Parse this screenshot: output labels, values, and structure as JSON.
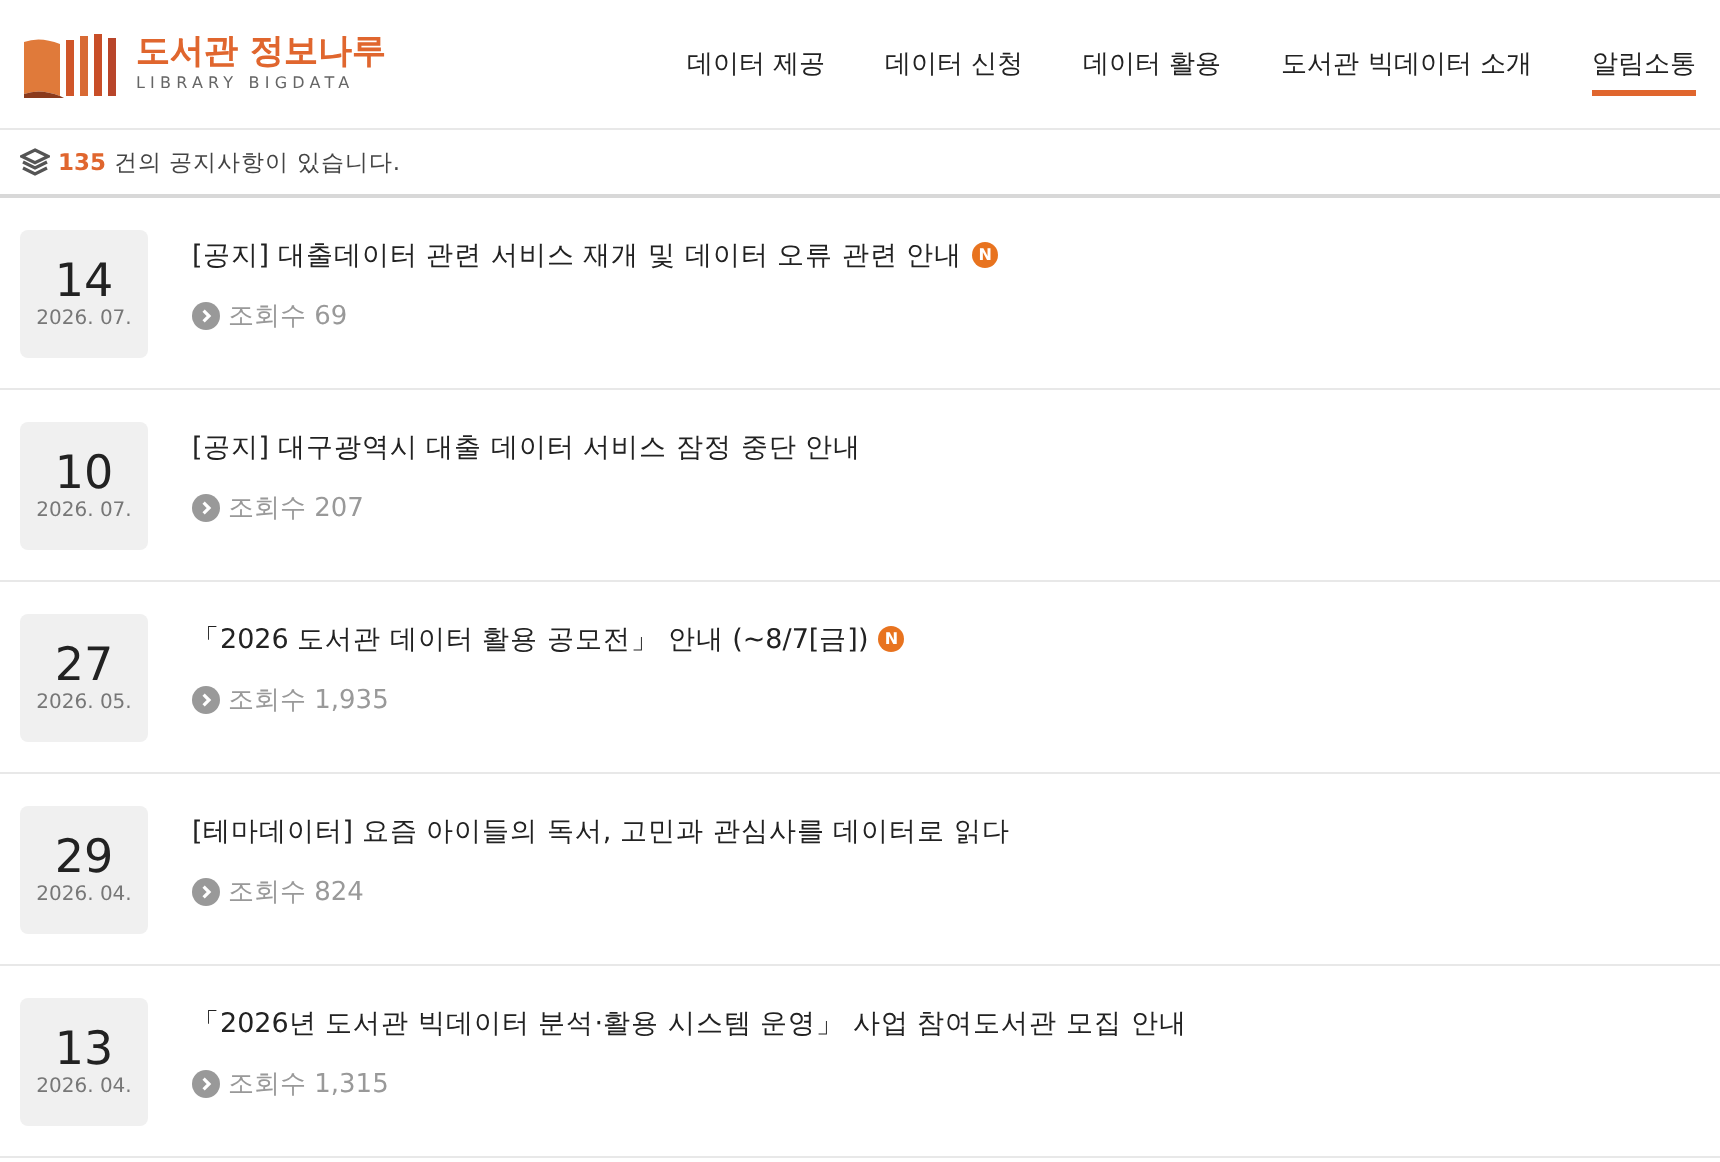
{
  "logo": {
    "title": "도서관 정보나루",
    "subtitle": "LIBRARY BIGDATA"
  },
  "nav": [
    {
      "label": "데이터 제공",
      "selected": false
    },
    {
      "label": "데이터 신청",
      "selected": false
    },
    {
      "label": "데이터 활용",
      "selected": false
    },
    {
      "label": "도서관 빅데이터 소개",
      "selected": false
    },
    {
      "label": "알림소통",
      "selected": true
    }
  ],
  "summary": {
    "count": "135",
    "text": "건의 공지사항이 있습니다."
  },
  "notices": [
    {
      "day": "14",
      "month": "2026. 07.",
      "title": "[공지] 대출데이터 관련 서비스 재개 및 데이터 오류 관련 안내",
      "badge": "N",
      "views_label": "조회수",
      "views": "69"
    },
    {
      "day": "10",
      "month": "2026. 07.",
      "title": "[공지] 대구광역시 대출 데이터 서비스 잠정 중단 안내",
      "views_label": "조회수",
      "views": "207"
    },
    {
      "day": "27",
      "month": "2026. 05.",
      "title": "「2026 도서관 데이터 활용 공모전」 안내 (~8/7[금])",
      "badge": "N",
      "views_label": "조회수",
      "views": "1,935"
    },
    {
      "day": "29",
      "month": "2026. 04.",
      "title": "[테마데이터] 요즘 아이들의 독서, 고민과 관심사를 데이터로 읽다",
      "views_label": "조회수",
      "views": "824"
    },
    {
      "day": "13",
      "month": "2026. 04.",
      "title": "「2026년 도서관 빅데이터 분석·활용 시스템 운영」 사업 참여도서관 모집 안내",
      "views_label": "조회수",
      "views": "1,315"
    }
  ]
}
